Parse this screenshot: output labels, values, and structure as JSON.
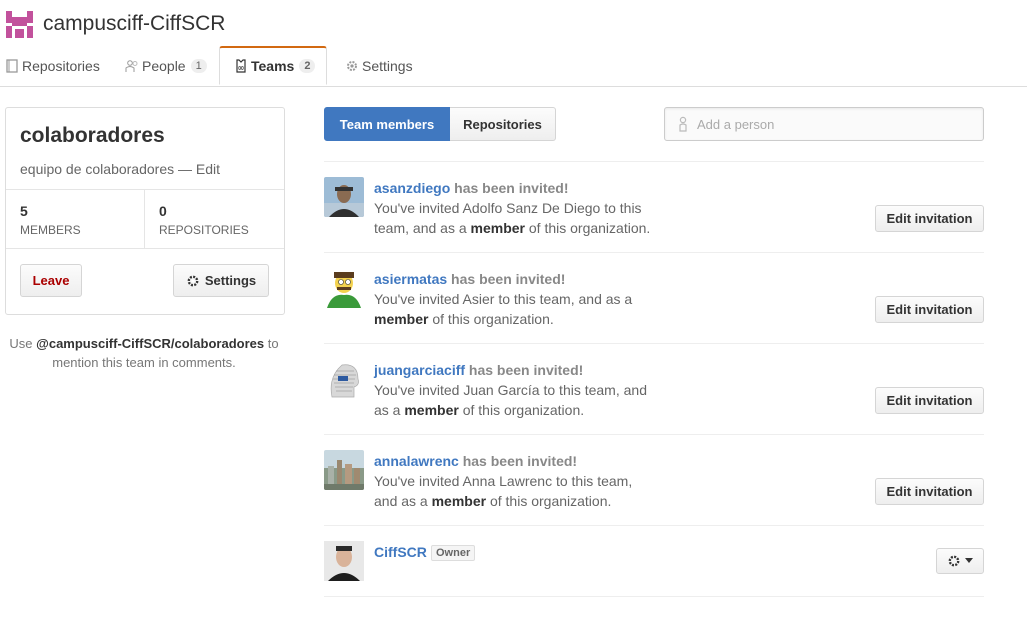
{
  "org": {
    "name": "campusciff-CiffSCR",
    "avatar_icon": "org-pixel-logo",
    "avatar_color": "#c2519c"
  },
  "tabs": [
    {
      "label": "Repositories",
      "icon": "repo-icon",
      "count": null,
      "selected": false
    },
    {
      "label": "People",
      "icon": "people-icon",
      "count": "1",
      "selected": false
    },
    {
      "label": "Teams",
      "icon": "jersey-icon",
      "count": "2",
      "selected": true
    },
    {
      "label": "Settings",
      "icon": "gear-icon",
      "count": null,
      "selected": false
    }
  ],
  "team": {
    "name": "colaboradores",
    "description": "equipo de colaboradores",
    "separator": " — ",
    "edit_label": "Edit",
    "members_count": "5",
    "members_label": "MEMBERS",
    "repos_count": "0",
    "repos_label": "REPOSITORIES",
    "leave_label": "Leave",
    "settings_label": "Settings"
  },
  "mention": {
    "prefix": "Use ",
    "handle": "@campusciff-CiffSCR/colaboradores",
    "suffix": " to mention this team in comments."
  },
  "segments": {
    "members": "Team members",
    "repositories": "Repositories"
  },
  "add_person": {
    "placeholder": "Add a person"
  },
  "invites": [
    {
      "username": "asanzdiego",
      "status": " has been invited!",
      "line_a": "You've invited Adolfo Sanz De Diego to this team, and as a ",
      "role": "member",
      "line_b": " of this organization.",
      "button": "Edit invitation"
    },
    {
      "username": "asiermatas",
      "status": " has been invited!",
      "line_a": "You've invited Asier to this team, and as a ",
      "role": "member",
      "line_b": " of this organization.",
      "button": "Edit invitation"
    },
    {
      "username": "juangarciaciff",
      "status": " has been invited!",
      "line_a": "You've invited Juan García to this team, and as a ",
      "role": "member",
      "line_b": " of this organization.",
      "button": "Edit invitation"
    },
    {
      "username": "annalawrenc",
      "status": " has been invited!",
      "line_a": "You've invited Anna Lawrenc to this team, and as a ",
      "role": "member",
      "line_b": " of this organization.",
      "button": "Edit invitation"
    }
  ],
  "owner": {
    "username": "CiffSCR",
    "badge": "Owner"
  },
  "colors": {
    "accent": "#4078c0",
    "tab_active_border": "#d26911",
    "leave_text": "#aa0000"
  }
}
